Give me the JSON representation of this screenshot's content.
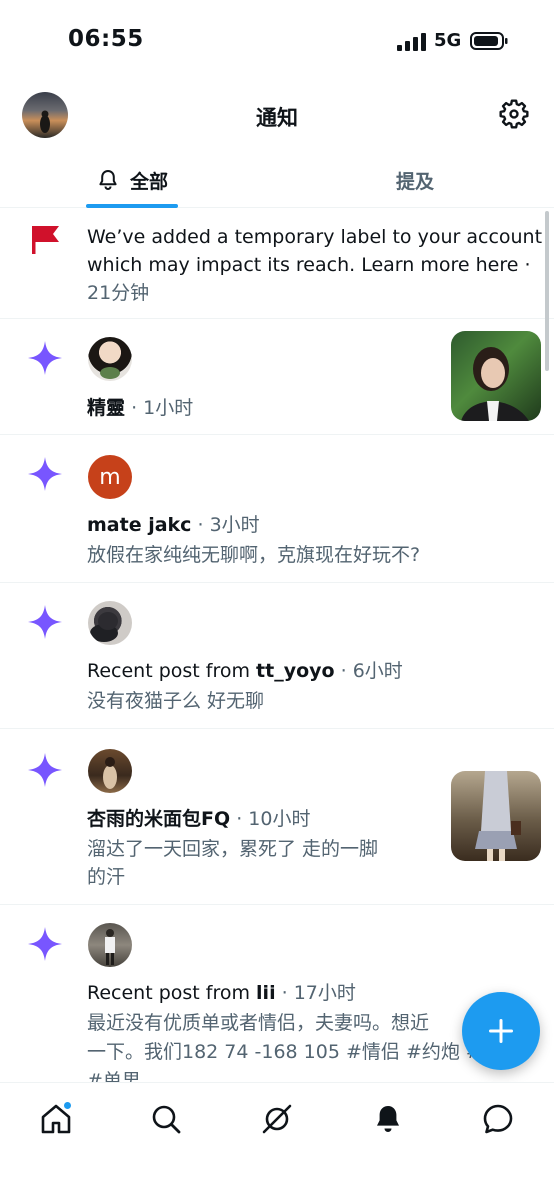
{
  "status_bar": {
    "time": "06:55",
    "network": "5G"
  },
  "header": {
    "title": "通知"
  },
  "tabs": [
    {
      "label": "全部",
      "active": true
    },
    {
      "label": "提及",
      "active": false
    }
  ],
  "colors": {
    "accent": "#1d9bf0",
    "star": "#7856ff",
    "flag": "#d0112b",
    "muted": "#536471"
  },
  "notifications": [
    {
      "icon": "flag-icon",
      "line1": "We’ve added a temporary label to your account",
      "line2": "which may impact its reach. Learn more here ·",
      "time": "21分钟"
    },
    {
      "icon": "sparkle-icon",
      "name": "精靈",
      "time": "· 1小时",
      "has_thumb": true
    },
    {
      "icon": "sparkle-icon",
      "avatar_letter": "m",
      "name": "mate jakc",
      "time": "· 3小时",
      "text": "放假在家纯纯无聊啊，克旗现在好玩不?"
    },
    {
      "icon": "sparkle-icon",
      "prefix": "Recent post from ",
      "name": "tt_yoyo",
      "time": "· 6小时",
      "text": "没有夜猫子么 好无聊"
    },
    {
      "icon": "sparkle-icon",
      "name": "杏雨的米面包FQ",
      "time": "· 10小时",
      "text_line1": "溜达了一天回家，累死了 走的一脚",
      "text_line2": "的汗",
      "has_thumb": true
    },
    {
      "icon": "sparkle-icon",
      "prefix": "Recent post from ",
      "name": "lii",
      "time": "· 17小时",
      "text_line1": "最近没有优质单或者情侣，夫妻吗。想近",
      "text_line2": "一下。我们182 74 -168 105 #情侣 #约炮 #",
      "text_line3": "#单男"
    }
  ],
  "bottom_nav": [
    "home-icon",
    "search-icon",
    "grok-icon",
    "notifications-icon",
    "messages-icon"
  ]
}
